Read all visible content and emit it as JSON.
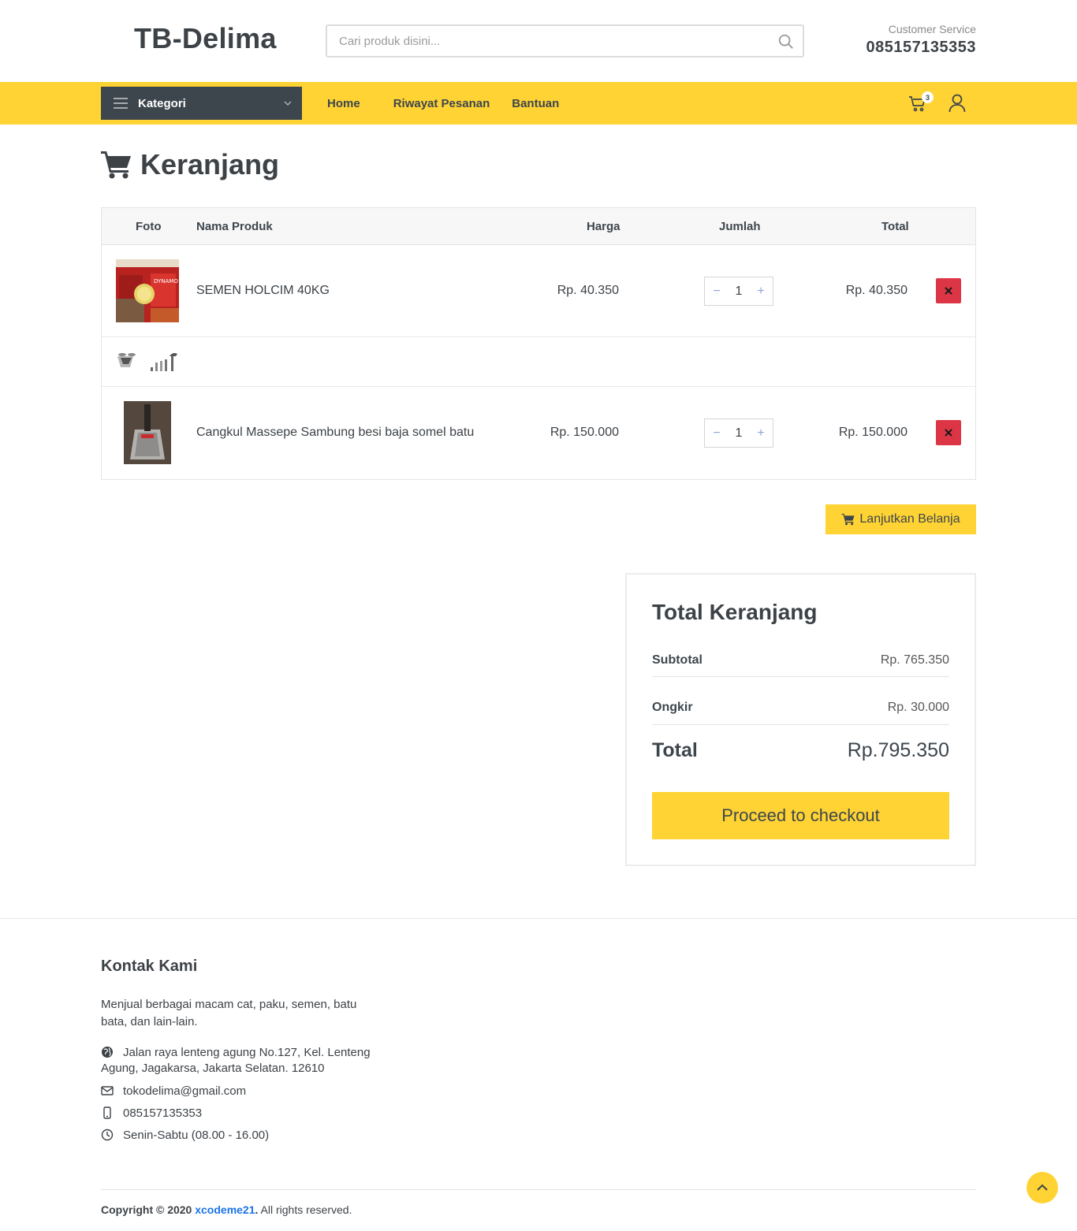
{
  "header": {
    "logo": "TB-Delima",
    "search_placeholder": "Cari produk disini...",
    "cs_label": "Customer Service",
    "cs_phone": "085157135353"
  },
  "nav": {
    "kategori": "Kategori",
    "links": [
      "Home",
      "Riwayat Pesanan",
      "Bantuan"
    ],
    "cart_count": "3"
  },
  "page": {
    "title": "Keranjang"
  },
  "table": {
    "headers": [
      "Foto",
      "Nama Produk",
      "Harga",
      "Jumlah",
      "Total"
    ],
    "items": [
      {
        "name": "SEMEN HOLCIM 40KG",
        "price": "Rp. 40.350",
        "qty": "1",
        "total": "Rp. 40.350"
      },
      {
        "name": "Cangkul Massepe Sambung besi baja somel batu",
        "price": "Rp. 150.000",
        "qty": "1",
        "total": "Rp. 150.000"
      }
    ]
  },
  "continue_label": "Lanjutkan Belanja",
  "totals": {
    "title": "Total Keranjang",
    "subtotal_label": "Subtotal",
    "subtotal": "Rp. 765.350",
    "ongkir_label": "Ongkir",
    "ongkir": "Rp. 30.000",
    "total_label": "Total",
    "total": "Rp.795.350",
    "checkout_label": "Proceed to checkout"
  },
  "footer": {
    "title": "Kontak Kami",
    "desc": "Menjual berbagai macam cat, paku, semen, batu bata, dan lain-lain.",
    "address": "Jalan raya lenteng agung No.127, Kel. Lenteng Agung, Jagakarsa, Jakarta Selatan. 12610",
    "email": "tokodelima@gmail.com",
    "phone": "085157135353",
    "hours": "Senin-Sabtu (08.00 - 16.00)",
    "copy_prefix": "Copyright © 2020",
    "copy_link": "xcodeme21",
    "copy_suffix": "All rights reserved."
  },
  "colors": {
    "accent": "#ffd333",
    "dark": "#3d464d",
    "danger": "#dc3545"
  }
}
